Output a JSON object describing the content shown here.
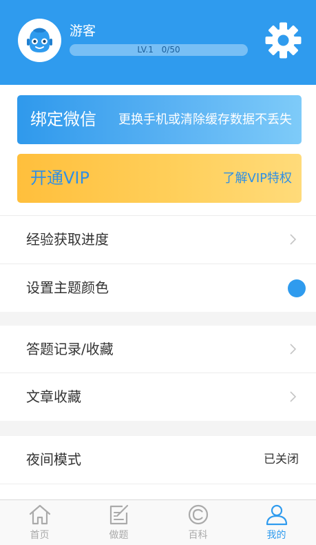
{
  "profile": {
    "username": "游客",
    "level": "LV.1",
    "exp": "0/50"
  },
  "banners": {
    "wechat": {
      "title": "绑定微信",
      "subtitle": "更换手机或清除缓存数据不丢失"
    },
    "vip": {
      "title": "开通VIP",
      "subtitle": "了解VIP特权"
    }
  },
  "menu": {
    "exp_progress": "经验获取进度",
    "theme_color": "设置主题颜色",
    "answer_records": "答题记录/收藏",
    "article_favorites": "文章收藏",
    "night_mode": "夜间模式",
    "night_mode_status": "已关闭"
  },
  "tabs": [
    {
      "label": "首页",
      "icon": "home-icon"
    },
    {
      "label": "做题",
      "icon": "edit-icon"
    },
    {
      "label": "百科",
      "icon": "copyright-icon"
    },
    {
      "label": "我的",
      "icon": "user-icon"
    }
  ],
  "colors": {
    "primary": "#2f9bee",
    "vip": "#ffc84a",
    "inactive_tab": "#aaaaaa"
  }
}
